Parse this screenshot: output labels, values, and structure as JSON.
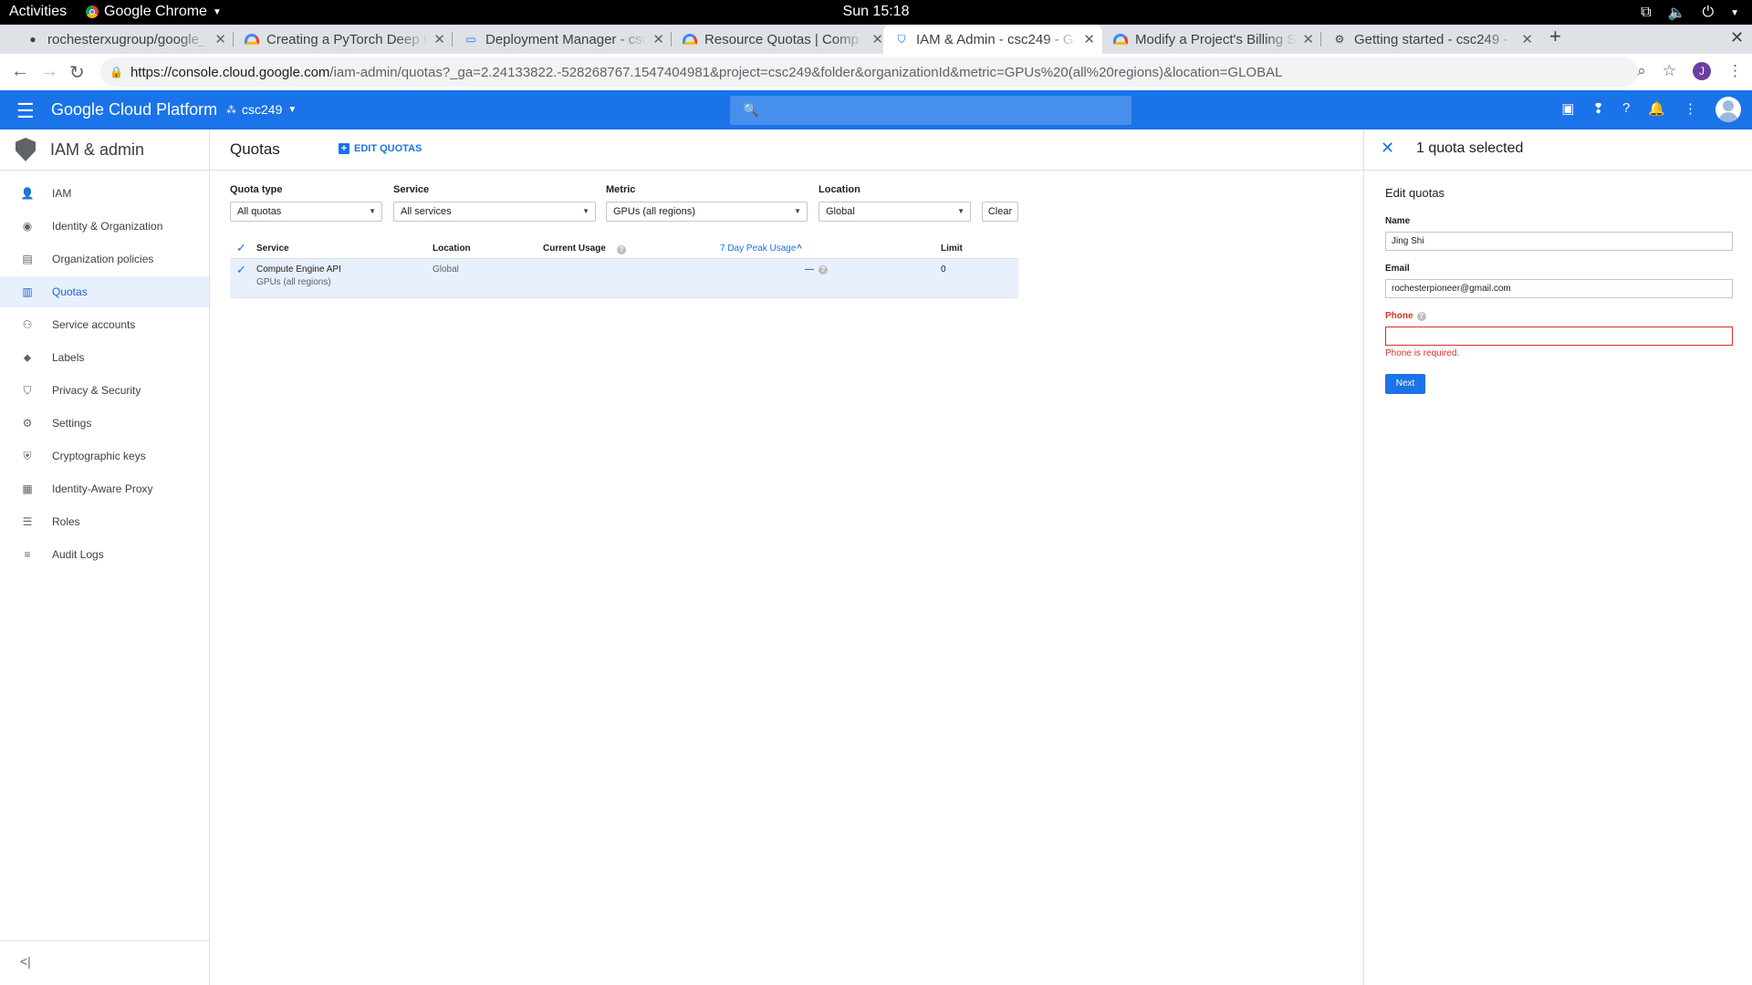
{
  "os_bar": {
    "activities": "Activities",
    "app_name": "Google Chrome",
    "clock": "Sun 15:18"
  },
  "browser": {
    "tabs": [
      {
        "title": "rochesterxugroup/google_",
        "icon": "github-icon",
        "active": false
      },
      {
        "title": "Creating a PyTorch Deep Le",
        "icon": "gcloud-icon",
        "active": false
      },
      {
        "title": "Deployment Manager - csc",
        "icon": "deployment-manager-icon",
        "active": false
      },
      {
        "title": "Resource Quotas  |  Comp",
        "icon": "gcloud-icon",
        "active": false
      },
      {
        "title": "IAM & Admin - csc249 - G",
        "icon": "shield-icon",
        "active": true
      },
      {
        "title": "Modify a Project's Billing S",
        "icon": "gcloud-icon",
        "active": false
      },
      {
        "title": "Getting started - csc249 -",
        "icon": "gear-icon",
        "active": false
      }
    ],
    "url_host": "https://console.cloud.google.com",
    "url_path": "/iam-admin/quotas?_ga=2.24133822.-528268767.1547404981&project=csc249&folder&organizationId&metric=GPUs%20(all%20regions)&location=GLOBAL",
    "profile_initial": "J"
  },
  "gcp_header": {
    "brand": "Google Cloud Platform",
    "project": "csc249"
  },
  "sidebar": {
    "title": "IAM & admin",
    "items": [
      {
        "label": "IAM",
        "icon": "person-add-icon",
        "active": false
      },
      {
        "label": "Identity & Organization",
        "icon": "account-circle-icon",
        "active": false
      },
      {
        "label": "Organization policies",
        "icon": "policy-doc-icon",
        "active": false
      },
      {
        "label": "Quotas",
        "icon": "quota-chart-icon",
        "active": true
      },
      {
        "label": "Service accounts",
        "icon": "service-account-icon",
        "active": false
      },
      {
        "label": "Labels",
        "icon": "tag-icon",
        "active": false
      },
      {
        "label": "Privacy & Security",
        "icon": "shield-icon",
        "active": false
      },
      {
        "label": "Settings",
        "icon": "gear-icon",
        "active": false
      },
      {
        "label": "Cryptographic keys",
        "icon": "key-shield-icon",
        "active": false
      },
      {
        "label": "Identity-Aware Proxy",
        "icon": "proxy-icon",
        "active": false
      },
      {
        "label": "Roles",
        "icon": "roles-icon",
        "active": false
      },
      {
        "label": "Audit Logs",
        "icon": "list-icon",
        "active": false
      }
    ]
  },
  "main": {
    "title": "Quotas",
    "edit_label": "EDIT QUOTAS",
    "filters": [
      {
        "label": "Quota type",
        "value": "All quotas"
      },
      {
        "label": "Service",
        "value": "All services"
      },
      {
        "label": "Metric",
        "value": "GPUs (all regions)"
      },
      {
        "label": "Location",
        "value": "Global"
      }
    ],
    "clear_label": "Clear",
    "table": {
      "headers": {
        "service": "Service",
        "location": "Location",
        "current_usage": "Current Usage",
        "peak_usage": "7 Day Peak Usage",
        "limit": "Limit"
      },
      "rows": [
        {
          "service": "Compute Engine API",
          "metric": "GPUs (all regions)",
          "location": "Global",
          "current_usage": "",
          "peak_usage": "—",
          "limit": "0",
          "checked": true
        }
      ]
    }
  },
  "panel": {
    "title": "1 quota selected",
    "section": "Edit quotas",
    "name_label": "Name",
    "name_value": "Jing Shi",
    "email_label": "Email",
    "email_value": "rochesterpioneer@gmail.com",
    "phone_label": "Phone",
    "phone_value": "",
    "phone_error": "Phone is required.",
    "next_label": "Next"
  },
  "colors": {
    "gcp_blue": "#1a73e8",
    "error_red": "#d93025",
    "active_nav_bg": "#e8f0fe"
  }
}
